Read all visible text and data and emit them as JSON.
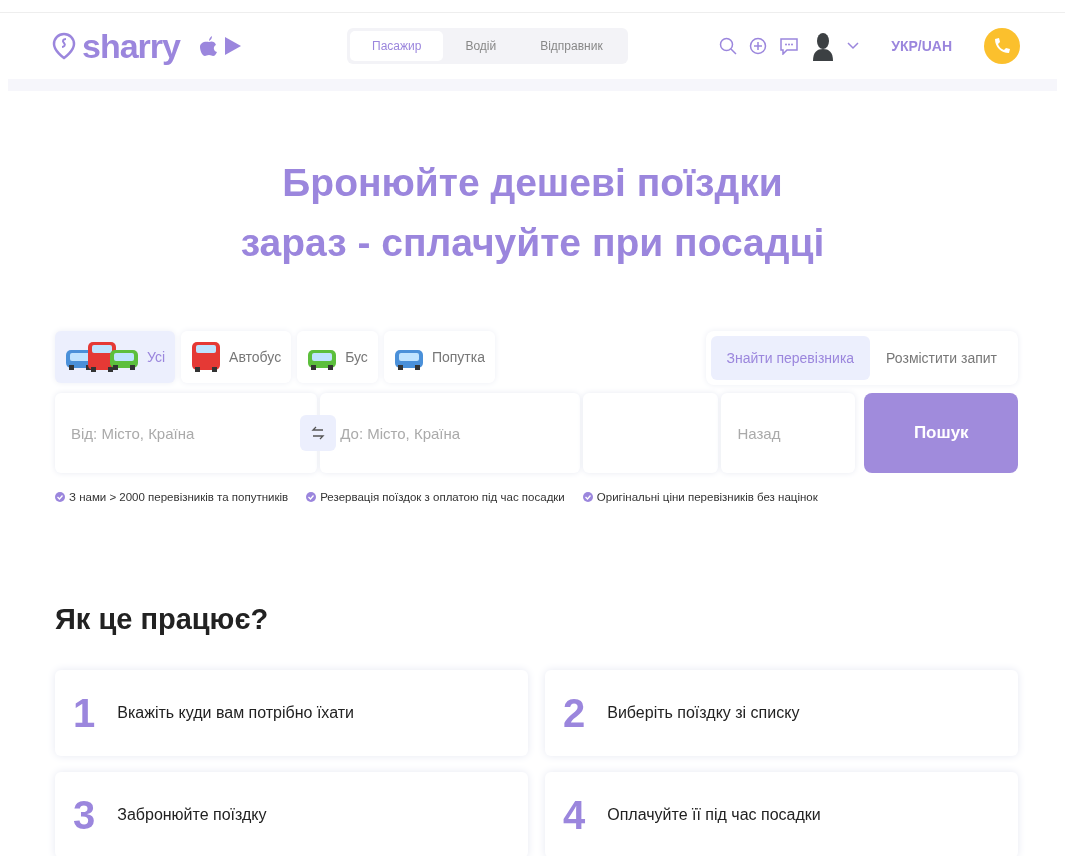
{
  "header": {
    "logo": "sharry",
    "role_tabs": [
      {
        "label": "Пасажир",
        "selected": true
      },
      {
        "label": "Водій",
        "selected": false
      },
      {
        "label": "Відправник",
        "selected": false
      }
    ],
    "language": "УКР/UAH"
  },
  "hero": {
    "title_lines": [
      "Бронюйте дешеві поїздки",
      "зараз - сплачуйте при посадці"
    ]
  },
  "search": {
    "vehicle_tabs": [
      {
        "label": "Усі",
        "kind": "all",
        "selected": true
      },
      {
        "label": "Автобус",
        "kind": "bus",
        "selected": false
      },
      {
        "label": "Бус",
        "kind": "van",
        "selected": false
      },
      {
        "label": "Попутка",
        "kind": "car",
        "selected": false
      }
    ],
    "mode_tabs": [
      {
        "label": "Знайти перевізника",
        "selected": true
      },
      {
        "label": "Розмістити запит",
        "selected": false
      }
    ],
    "from": {
      "placeholder": "Від: Місто, Країна"
    },
    "to": {
      "placeholder": "До: Місто, Країна"
    },
    "back": {
      "placeholder": "Назад"
    },
    "button": "Пошук"
  },
  "features": [
    "З нами > 2000 перевізників та попутників",
    "Резервація поїздок з оплатою під час посадки",
    "Оригінальні ціни перевізників без націнок"
  ],
  "how": {
    "title": "Як це працює?",
    "steps": [
      {
        "number": "1",
        "text": "Вкажіть куди вам потрібно їхати"
      },
      {
        "number": "2",
        "text": "Виберіть поїздку зі списку"
      },
      {
        "number": "3",
        "text": "Забронюйте поїздку"
      },
      {
        "number": "4",
        "text": "Оплачуйте її під час посадки"
      }
    ]
  }
}
